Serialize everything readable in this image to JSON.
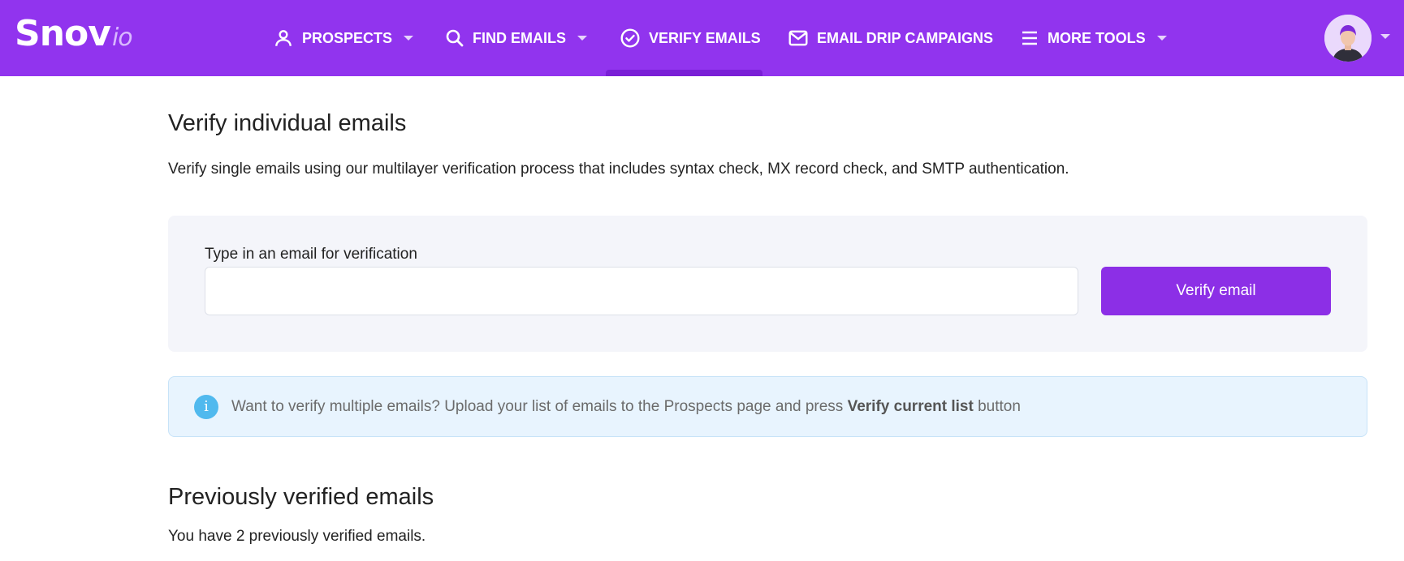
{
  "brand": {
    "name": "Snov",
    "suffix": "io"
  },
  "nav": {
    "prospects": "PROSPECTS",
    "find_emails": "FIND EMAILS",
    "verify_emails": "VERIFY EMAILS",
    "drip": "EMAIL DRIP CAMPAIGNS",
    "more_tools": "MORE TOOLS",
    "active": "verify_emails"
  },
  "colors": {
    "brand": "#9134ee",
    "button": "#8c2fe6",
    "info_bg": "#e8f4fe",
    "info_icon": "#50b9ee"
  },
  "main": {
    "title": "Verify individual emails",
    "description": "Verify single emails using our multilayer verification process that includes syntax check, MX record check, and SMTP authentication.",
    "field_label": "Type in an email for verification",
    "email_value": "",
    "button_label": "Verify email"
  },
  "info": {
    "icon": "info-icon",
    "text_before": "Want to verify multiple emails? Upload your list of emails to the Prospects page and press ",
    "text_bold": "Verify current list",
    "text_after": " button"
  },
  "history": {
    "title": "Previously verified emails",
    "count_text": "You have 2 previously verified emails."
  }
}
